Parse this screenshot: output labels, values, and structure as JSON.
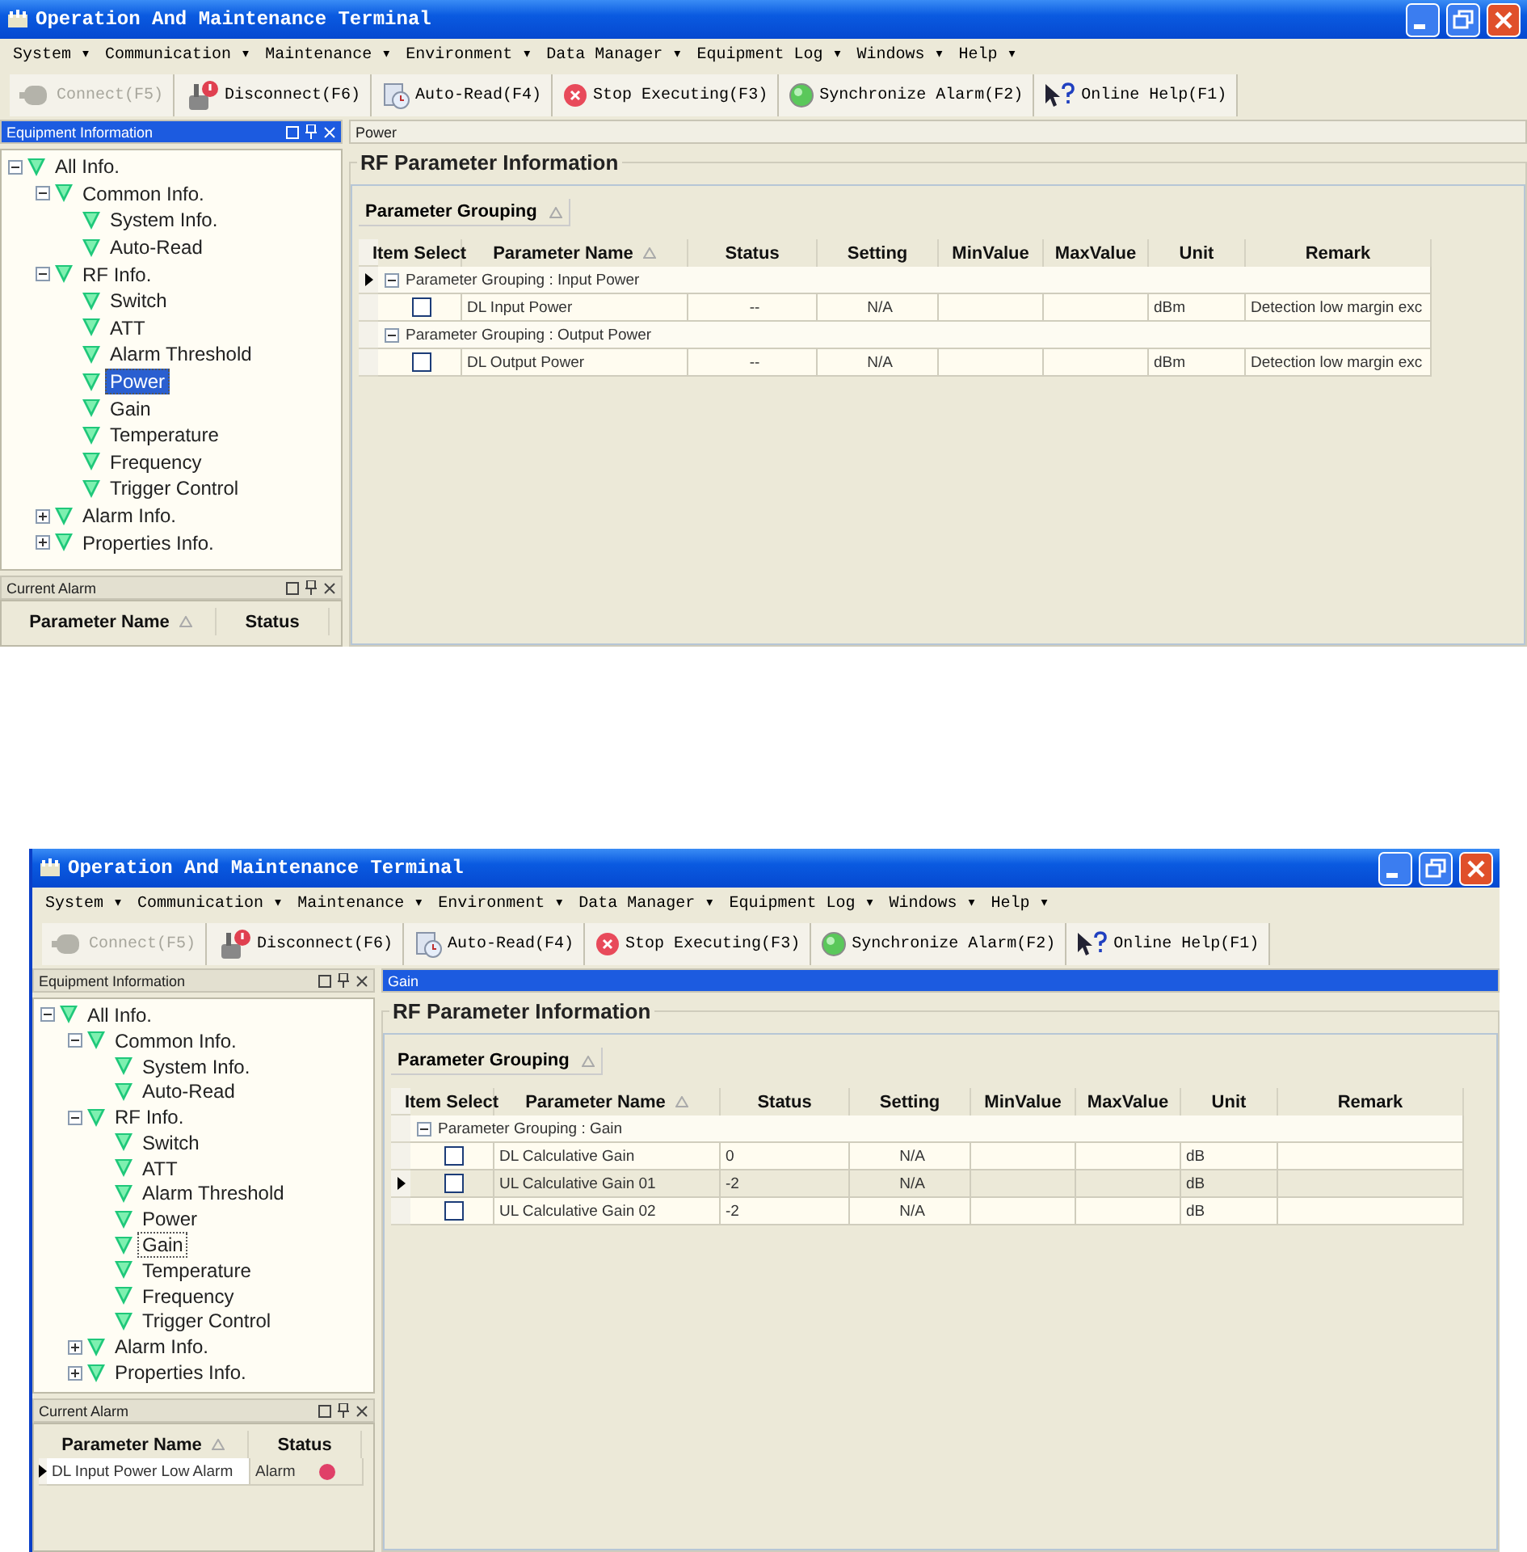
{
  "screenshots": [
    {
      "window": {
        "title": "Operation And Maintenance Terminal"
      },
      "menu": [
        "System ▾",
        "Communication ▾",
        "Maintenance ▾",
        "Environment ▾",
        "Data Manager ▾",
        "Equipment Log ▾",
        "Windows ▾",
        "Help ▾"
      ],
      "toolbar": [
        {
          "label": "Connect(F5)",
          "disabled": true
        },
        {
          "label": "Disconnect(F6)",
          "disabled": false
        },
        {
          "label": "Auto-Read(F4)",
          "disabled": false
        },
        {
          "label": "Stop Executing(F3)",
          "disabled": false
        },
        {
          "label": "Synchronize Alarm(F2)",
          "disabled": false
        },
        {
          "label": "Online Help(F1)",
          "disabled": false
        }
      ],
      "equipment_panel": {
        "title": "Equipment Information",
        "active": true,
        "tree": [
          {
            "label": "All Info.",
            "expanded": true,
            "selected": false,
            "children": [
              {
                "label": "Common Info.",
                "expanded": true,
                "selected": false,
                "children": [
                  {
                    "label": "System Info.",
                    "selected": false
                  },
                  {
                    "label": "Auto-Read",
                    "selected": false
                  }
                ]
              },
              {
                "label": "RF Info.",
                "expanded": true,
                "selected": false,
                "children": [
                  {
                    "label": "Switch",
                    "selected": false
                  },
                  {
                    "label": "ATT",
                    "selected": false
                  },
                  {
                    "label": "Alarm Threshold",
                    "selected": false
                  },
                  {
                    "label": "Power",
                    "selected": true
                  },
                  {
                    "label": "Gain",
                    "selected": false
                  },
                  {
                    "label": "Temperature",
                    "selected": false
                  },
                  {
                    "label": "Frequency",
                    "selected": false
                  },
                  {
                    "label": "Trigger Control",
                    "selected": false
                  }
                ]
              },
              {
                "label": "Alarm Info.",
                "expanded": false,
                "selected": false
              },
              {
                "label": "Properties Info.",
                "expanded": false,
                "selected": false
              }
            ]
          }
        ]
      },
      "alarm_panel": {
        "title": "Current Alarm",
        "columns": [
          {
            "label": "Parameter Name",
            "sorted": true
          },
          {
            "label": "Status",
            "sorted": false
          }
        ]
      },
      "content": {
        "tab": "Power",
        "active": false,
        "section_title": "RF Parameter Information",
        "grouping_label": "Parameter Grouping",
        "columns": [
          {
            "label": "Item Select",
            "sorted": false
          },
          {
            "label": "Parameter Name",
            "sorted": true
          },
          {
            "label": "Status",
            "sorted": false
          },
          {
            "label": "Setting",
            "sorted": false
          },
          {
            "label": "MinValue",
            "sorted": false
          },
          {
            "label": "MaxValue",
            "sorted": false
          },
          {
            "label": "Unit",
            "sorted": false
          },
          {
            "label": "Remark",
            "sorted": false
          }
        ],
        "groups": [
          {
            "label": "Parameter Grouping : Input Power",
            "expanded": true,
            "current": true,
            "rows": [
              {
                "checked": false,
                "current": false,
                "cells": [
                  "DL Input Power",
                  "--",
                  "N/A",
                  "",
                  "",
                  "dBm",
                  "Detection low margin exc"
                ]
              }
            ]
          },
          {
            "label": "Parameter Grouping : Output Power",
            "expanded": true,
            "current": false,
            "rows": [
              {
                "checked": false,
                "current": false,
                "cells": [
                  "DL Output Power",
                  "--",
                  "N/A",
                  "",
                  "",
                  "dBm",
                  "Detection low margin exc"
                ]
              }
            ]
          }
        ]
      }
    },
    {
      "window": {
        "title": "Operation And Maintenance Terminal"
      },
      "menu": [
        "System ▾",
        "Communication ▾",
        "Maintenance ▾",
        "Environment ▾",
        "Data Manager ▾",
        "Equipment Log ▾",
        "Windows ▾",
        "Help ▾"
      ],
      "toolbar": [
        {
          "label": "Connect(F5)",
          "disabled": true
        },
        {
          "label": "Disconnect(F6)",
          "disabled": false
        },
        {
          "label": "Auto-Read(F4)",
          "disabled": false
        },
        {
          "label": "Stop Executing(F3)",
          "disabled": false
        },
        {
          "label": "Synchronize Alarm(F2)",
          "disabled": false
        },
        {
          "label": "Online Help(F1)",
          "disabled": false
        }
      ],
      "equipment_panel": {
        "title": "Equipment Information",
        "active": false,
        "tree": [
          {
            "label": "All Info.",
            "expanded": true,
            "selected": false,
            "children": [
              {
                "label": "Common Info.",
                "expanded": true,
                "selected": false,
                "children": [
                  {
                    "label": "System Info.",
                    "selected": false
                  },
                  {
                    "label": "Auto-Read",
                    "selected": false
                  }
                ]
              },
              {
                "label": "RF Info.",
                "expanded": true,
                "selected": false,
                "children": [
                  {
                    "label": "Switch",
                    "selected": false
                  },
                  {
                    "label": "ATT",
                    "selected": false
                  },
                  {
                    "label": "Alarm Threshold",
                    "selected": false
                  },
                  {
                    "label": "Power",
                    "selected": false
                  },
                  {
                    "label": "Gain",
                    "selected": true
                  },
                  {
                    "label": "Temperature",
                    "selected": false
                  },
                  {
                    "label": "Frequency",
                    "selected": false
                  },
                  {
                    "label": "Trigger Control",
                    "selected": false
                  }
                ]
              },
              {
                "label": "Alarm Info.",
                "expanded": false,
                "selected": false
              },
              {
                "label": "Properties Info.",
                "expanded": false,
                "selected": false
              }
            ]
          }
        ]
      },
      "alarm_panel": {
        "title": "Current Alarm",
        "columns": [
          {
            "label": "Parameter Name",
            "sorted": true
          },
          {
            "label": "Status",
            "sorted": false
          }
        ],
        "rows": [
          {
            "name": "DL Input Power Low Alarm",
            "status": "Alarm",
            "current": true
          }
        ]
      },
      "content": {
        "tab": "Gain",
        "active": true,
        "section_title": "RF Parameter Information",
        "grouping_label": "Parameter Grouping",
        "columns": [
          {
            "label": "Item Select",
            "sorted": false
          },
          {
            "label": "Parameter Name",
            "sorted": true
          },
          {
            "label": "Status",
            "sorted": false
          },
          {
            "label": "Setting",
            "sorted": false
          },
          {
            "label": "MinValue",
            "sorted": false
          },
          {
            "label": "MaxValue",
            "sorted": false
          },
          {
            "label": "Unit",
            "sorted": false
          },
          {
            "label": "Remark",
            "sorted": false
          }
        ],
        "groups": [
          {
            "label": "Parameter Grouping : Gain",
            "expanded": true,
            "current": false,
            "rows": [
              {
                "checked": false,
                "current": false,
                "cells": [
                  "DL Calculative Gain",
                  "0",
                  "N/A",
                  "",
                  "",
                  "dB",
                  ""
                ]
              },
              {
                "checked": false,
                "current": true,
                "cells": [
                  "UL Calculative Gain 01",
                  "-2",
                  "N/A",
                  "",
                  "",
                  "dB",
                  ""
                ]
              },
              {
                "checked": false,
                "current": false,
                "cells": [
                  "UL Calculative Gain 02",
                  "-2",
                  "N/A",
                  "",
                  "",
                  "dB",
                  ""
                ]
              }
            ]
          }
        ]
      }
    }
  ]
}
